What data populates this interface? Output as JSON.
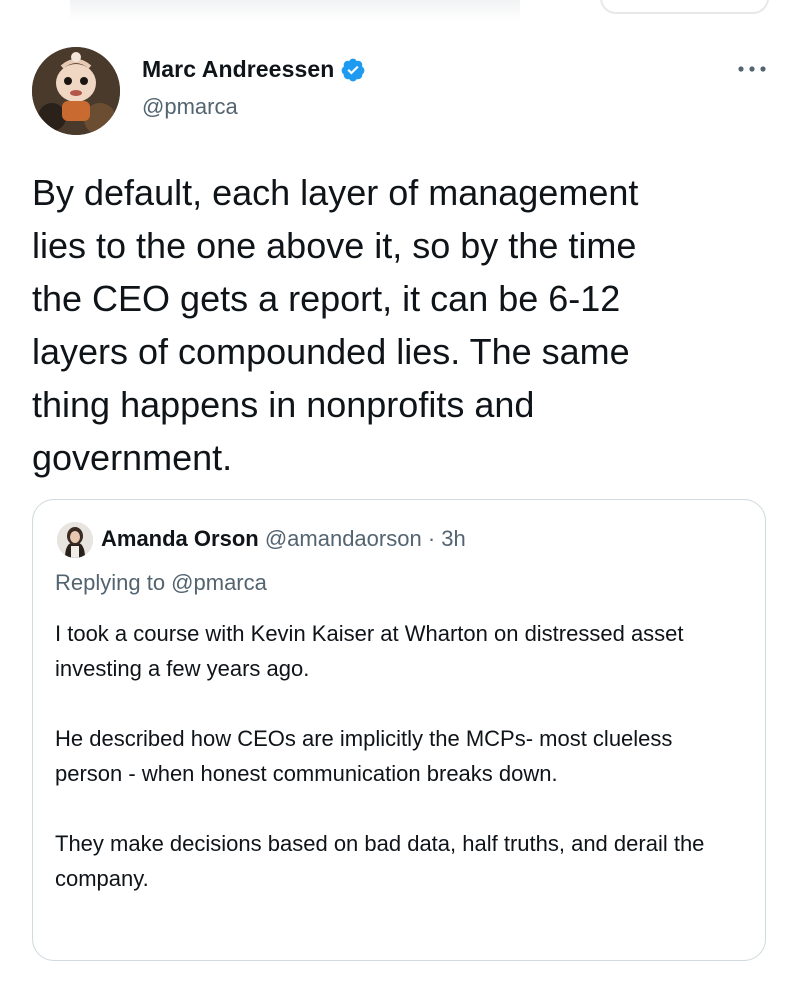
{
  "tweet": {
    "author_name": "Marc Andreessen",
    "author_handle": "@pmarca",
    "text": "By default, each layer of management\nlies to the one above it, so by the time\nthe CEO gets a report, it can be 6-12\nlayers of compounded lies. The same\nthing happens in nonprofits and\ngovernment.",
    "verified_icon": "verified-badge-icon",
    "more_icon": "more-options-icon"
  },
  "quoted_tweet": {
    "author_name": "Amanda Orson",
    "author_handle": "@amandaorson",
    "separator": "·",
    "time": "3h",
    "replying_to": "Replying to @pmarca",
    "paragraphs": [
      "I took a course with Kevin Kaiser at Wharton on distressed asset investing a few years ago.",
      "He described how CEOs are implicitly the MCPs- most clueless person - when honest communication breaks down.",
      "They make decisions based on bad data, half truths, and derail the company."
    ]
  },
  "colors": {
    "text_primary": "#0f1419",
    "text_secondary": "#536471",
    "verified_blue": "#1d9bf0",
    "card_border": "#cfd9de"
  }
}
